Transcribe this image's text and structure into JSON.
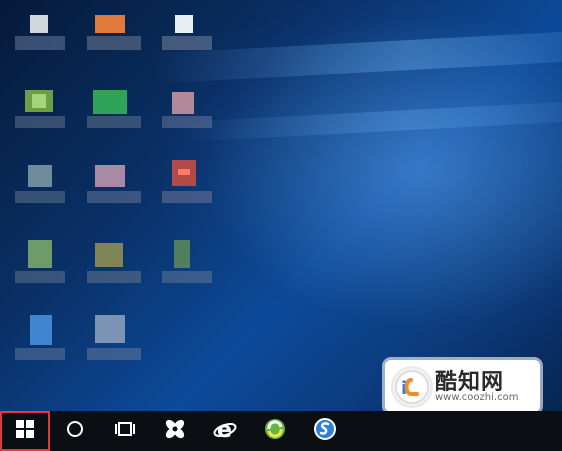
{
  "desktop": {
    "icon_count": 14,
    "icons_blurred": true
  },
  "taskbar": {
    "items": [
      {
        "name": "start-button",
        "icon": "windows-logo-icon",
        "highlighted": true
      },
      {
        "name": "cortana-button",
        "icon": "cortana-circle-icon"
      },
      {
        "name": "task-view-button",
        "icon": "task-view-icon"
      },
      {
        "name": "pinwheel-app-button",
        "icon": "pinwheel-icon"
      },
      {
        "name": "internet-explorer-button",
        "icon": "internet-explorer-icon"
      },
      {
        "name": "browser-360-button",
        "icon": "green-browser-icon"
      },
      {
        "name": "sogou-browser-button",
        "icon": "blue-s-icon"
      }
    ],
    "highlight_color": "#e0393e"
  },
  "watermark": {
    "title": "酷知网",
    "url": "www.coozhi.com",
    "accent_colors": [
      "#2c7be5",
      "#f28c1f"
    ]
  }
}
